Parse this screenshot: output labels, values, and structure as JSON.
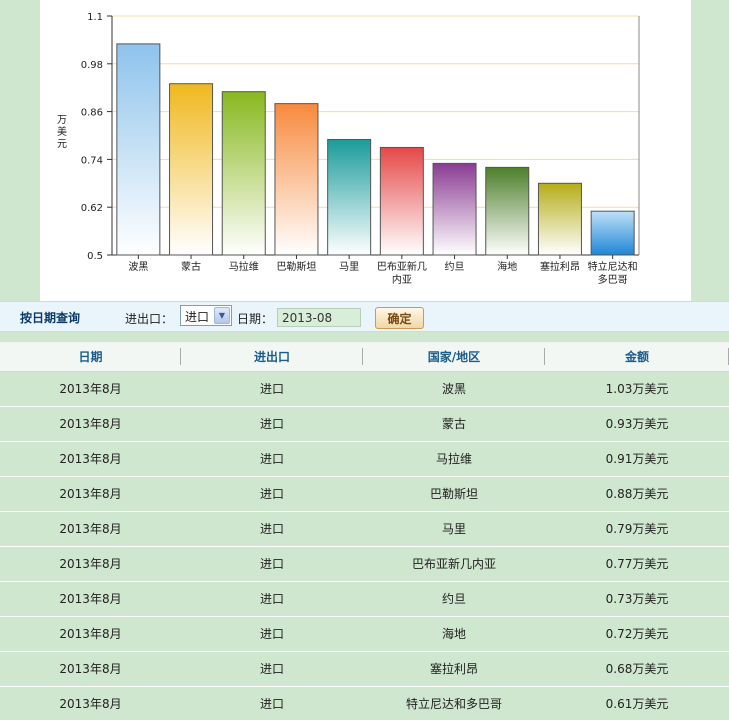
{
  "chart_data": {
    "type": "bar",
    "ylabel": "万美元",
    "ylim": [
      0.5,
      1.1
    ],
    "yticks": [
      "1.1",
      "0.98",
      "0.86",
      "0.74",
      "0.62",
      "0.5"
    ],
    "categories": [
      "波黑",
      "蒙古",
      "马拉维",
      "巴勒斯坦",
      "马里",
      "巴布亚新几内亚",
      "约旦",
      "海地",
      "塞拉利昂",
      "特立尼达和多巴哥"
    ],
    "values": [
      1.03,
      0.93,
      0.91,
      0.88,
      0.79,
      0.77,
      0.73,
      0.72,
      0.68,
      0.61
    ],
    "colors": [
      "#8ec3ec",
      "#f0b81e",
      "#88b81e",
      "#f78a3e",
      "#1a9b9b",
      "#e54848",
      "#8a3c92",
      "#4e7f2b",
      "#b5ad19",
      "#2a8fd8"
    ]
  },
  "query": {
    "title": "按日期查询",
    "io_label": "进出口：",
    "io_value": "进口",
    "date_label": "日期：",
    "date_value": "2013-08",
    "confirm": "确定"
  },
  "table": {
    "headers": [
      "日期",
      "进出口",
      "国家/地区",
      "金额"
    ],
    "rows": [
      [
        "2013年8月",
        "进口",
        "波黑",
        "1.03万美元"
      ],
      [
        "2013年8月",
        "进口",
        "蒙古",
        "0.93万美元"
      ],
      [
        "2013年8月",
        "进口",
        "马拉维",
        "0.91万美元"
      ],
      [
        "2013年8月",
        "进口",
        "巴勒斯坦",
        "0.88万美元"
      ],
      [
        "2013年8月",
        "进口",
        "马里",
        "0.79万美元"
      ],
      [
        "2013年8月",
        "进口",
        "巴布亚新几内亚",
        "0.77万美元"
      ],
      [
        "2013年8月",
        "进口",
        "约旦",
        "0.73万美元"
      ],
      [
        "2013年8月",
        "进口",
        "海地",
        "0.72万美元"
      ],
      [
        "2013年8月",
        "进口",
        "塞拉利昂",
        "0.68万美元"
      ],
      [
        "2013年8月",
        "进口",
        "特立尼达和多巴哥",
        "0.61万美元"
      ]
    ]
  }
}
